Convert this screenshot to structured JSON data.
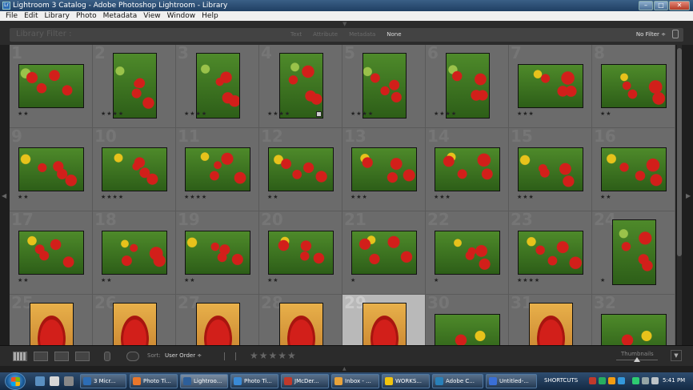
{
  "window": {
    "title": "Lightroom 3 Catalog - Adobe Photoshop Lightroom - Library"
  },
  "menu": [
    "File",
    "Edit",
    "Library",
    "Photo",
    "Metadata",
    "View",
    "Window",
    "Help"
  ],
  "filter_bar": {
    "label": "Library Filter :",
    "tabs": [
      {
        "label": "Text",
        "active": false
      },
      {
        "label": "Attribute",
        "active": false
      },
      {
        "label": "Metadata",
        "active": false
      },
      {
        "label": "None",
        "active": true
      }
    ],
    "preset": "No Filter ÷"
  },
  "grid": {
    "cells": [
      {
        "num": "1",
        "stars": "★★",
        "orient": "land"
      },
      {
        "num": "2",
        "stars": "★★★★",
        "orient": "port"
      },
      {
        "num": "3",
        "stars": "★★★★",
        "orient": "port"
      },
      {
        "num": "4",
        "stars": "★★★★",
        "orient": "port",
        "badge": true
      },
      {
        "num": "5",
        "stars": "★★★★",
        "orient": "port"
      },
      {
        "num": "6",
        "stars": "★★★★",
        "orient": "port"
      },
      {
        "num": "7",
        "stars": "★★★",
        "orient": "land"
      },
      {
        "num": "8",
        "stars": "★★",
        "orient": "land"
      },
      {
        "num": "9",
        "stars": "★★",
        "orient": "land"
      },
      {
        "num": "10",
        "stars": "★★★★",
        "orient": "land"
      },
      {
        "num": "11",
        "stars": "★★★★",
        "orient": "land"
      },
      {
        "num": "12",
        "stars": "★★",
        "orient": "land"
      },
      {
        "num": "13",
        "stars": "★★★",
        "orient": "land"
      },
      {
        "num": "14",
        "stars": "★★★",
        "orient": "land"
      },
      {
        "num": "15",
        "stars": "★★★",
        "orient": "land"
      },
      {
        "num": "16",
        "stars": "★★",
        "orient": "land"
      },
      {
        "num": "17",
        "stars": "★★",
        "orient": "land"
      },
      {
        "num": "18",
        "stars": "★★",
        "orient": "land"
      },
      {
        "num": "19",
        "stars": "★★",
        "orient": "land"
      },
      {
        "num": "20",
        "stars": "★★",
        "orient": "land"
      },
      {
        "num": "21",
        "stars": "★",
        "orient": "land"
      },
      {
        "num": "22",
        "stars": "★",
        "orient": "land"
      },
      {
        "num": "23",
        "stars": "★★★★",
        "orient": "land"
      },
      {
        "num": "24",
        "stars": "★",
        "orient": "port"
      },
      {
        "num": "25",
        "stars": "",
        "orient": "port"
      },
      {
        "num": "26",
        "stars": "",
        "orient": "port"
      },
      {
        "num": "27",
        "stars": "",
        "orient": "port"
      },
      {
        "num": "28",
        "stars": "",
        "orient": "port"
      },
      {
        "num": "29",
        "stars": "",
        "orient": "port",
        "selected": true
      },
      {
        "num": "30",
        "stars": "",
        "orient": "land"
      },
      {
        "num": "31",
        "stars": "",
        "orient": "port"
      },
      {
        "num": "32",
        "stars": "",
        "orient": "land"
      }
    ]
  },
  "toolbar": {
    "sort_label": "Sort:",
    "sort_value": "User Order ÷",
    "rating_stars": "★★★★★",
    "thumbnails_label": "Thumbnails"
  },
  "taskbar": {
    "items": [
      {
        "label": "3 Micr...",
        "color": "#2d6db5"
      },
      {
        "label": "Photo Ti...",
        "color": "#e8762b"
      },
      {
        "label": "Lightroo...",
        "color": "#2d5f9a",
        "active": true
      },
      {
        "label": "Photo Ti...",
        "color": "#3a8ad6"
      },
      {
        "label": "JMcDer...",
        "color": "#c0392b"
      },
      {
        "label": "Inbox - ...",
        "color": "#e8a33b"
      },
      {
        "label": "WORKS...",
        "color": "#f1c40f"
      },
      {
        "label": "Adobe C...",
        "color": "#2980b9"
      },
      {
        "label": "Untitled-...",
        "color": "#3a6fd6"
      }
    ],
    "shortcuts": "SHORTCUTS",
    "clock": "5:41 PM"
  },
  "colors": {
    "panel_bg": "#2b2b2b",
    "grid_cell": "#6b6b6b",
    "selected_cell": "#b9b9b9",
    "tulip_red": "#d21f1a",
    "tulip_yellow": "#e7c21b",
    "foliage_green": "#4e8a2a"
  }
}
